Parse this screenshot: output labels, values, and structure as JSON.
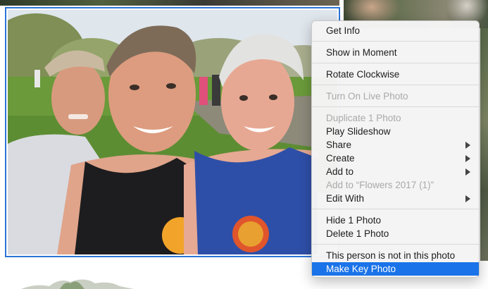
{
  "context_menu": {
    "items": [
      {
        "label": "Get Info",
        "enabled": true
      },
      {
        "label": "Show in Moment",
        "enabled": true
      },
      {
        "label": "Rotate Clockwise",
        "enabled": true
      },
      {
        "label": "Turn On Live Photo",
        "enabled": false
      },
      {
        "label": "Duplicate 1 Photo",
        "enabled": false
      },
      {
        "label": "Play Slideshow",
        "enabled": true
      },
      {
        "label": "Share",
        "enabled": true,
        "submenu": true
      },
      {
        "label": "Create",
        "enabled": true,
        "submenu": true
      },
      {
        "label": "Add to",
        "enabled": true,
        "submenu": true
      },
      {
        "label": "Add to “Flowers 2017 (1)”",
        "enabled": false
      },
      {
        "label": "Edit With",
        "enabled": true,
        "submenu": true
      },
      {
        "label": "Hide 1 Photo",
        "enabled": true
      },
      {
        "label": "Delete 1 Photo",
        "enabled": true
      },
      {
        "label": "This person is not in this photo",
        "enabled": true
      },
      {
        "label": "Make Key Photo",
        "enabled": true,
        "highlighted": true
      }
    ]
  },
  "colors": {
    "selection_border": "#2a74d6",
    "highlight": "#1a73e8",
    "disabled_text": "#a9a9a9",
    "menu_background": "#f4f4f4"
  },
  "icons": {
    "submenu": "chevron-right-icon"
  }
}
